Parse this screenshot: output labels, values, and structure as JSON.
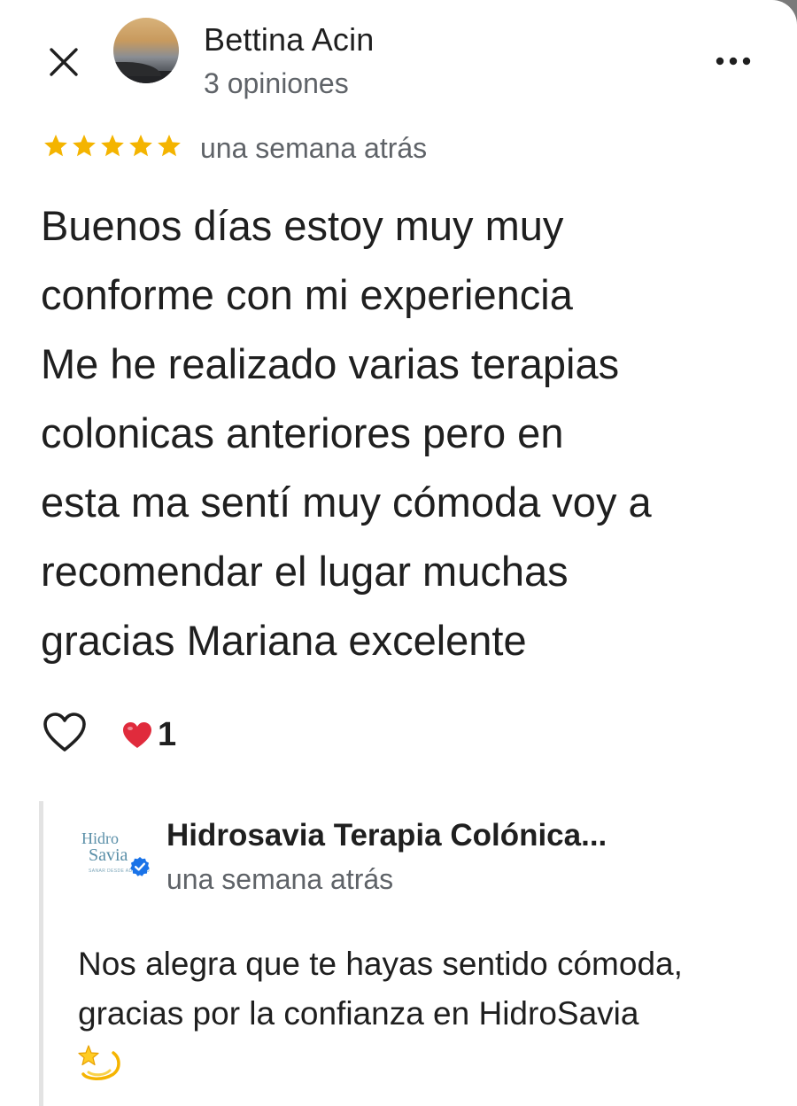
{
  "header": {
    "reviewer_name": "Bettina Acin",
    "reviewer_meta": "3 opiniones",
    "close_icon": "close-icon",
    "more_icon": "more-horizontal-icon"
  },
  "review": {
    "rating": 5,
    "max_rating": 5,
    "date": "una semana atrás",
    "text": "Buenos días estoy muy muy\nconforme con mi experiencia\nMe he realizado varias terapias\ncolonicas anteriores pero en\nesta ma sentí muy cómoda voy a\nrecomendar el lugar muchas\ngracias Mariana excelente",
    "star_color": "#f4b400"
  },
  "reactions": {
    "like_icon": "heart-outline-icon",
    "heart_icon": "red-heart-icon",
    "heart_count": "1",
    "heart_color": "#e02b3c"
  },
  "owner_reply": {
    "name": "Hidrosavia Terapia Colónica...",
    "date": "una semana atrás",
    "logo_line1": "Hidro",
    "logo_line2": "Savia",
    "verified_icon": "verified-badge-icon",
    "text": "Nos alegra que te hayas sentido cómoda,\ngracias por la confianza en HidroSavia",
    "emoji_icon": "dizzy-star-icon",
    "badge_color": "#1a73e8"
  }
}
